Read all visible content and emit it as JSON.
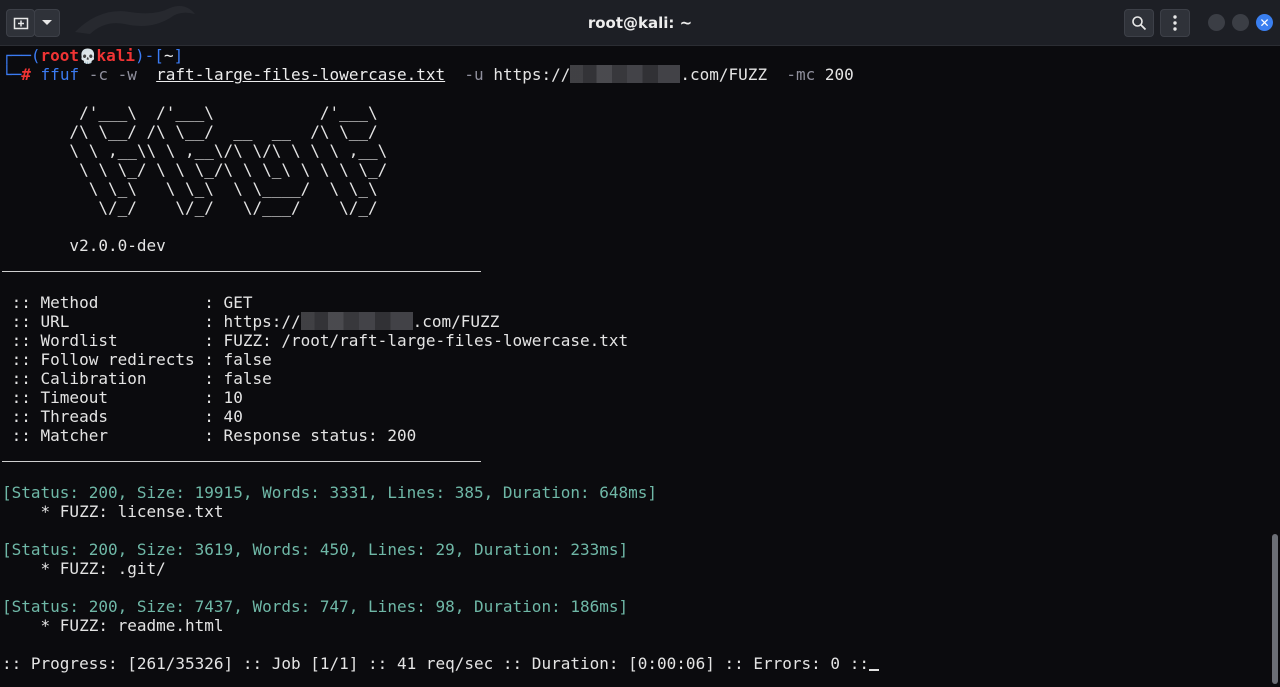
{
  "window": {
    "title": "root@kali: ~",
    "new_tab_icon": "new-tab-icon",
    "dropdown_icon": "chevron-down-icon",
    "search_icon": "search-icon",
    "menu_icon": "kebab-menu-icon",
    "close_icon": "close-icon"
  },
  "prompt": {
    "open": "┌──(",
    "user": "root",
    "skull": "💀",
    "host": "kali",
    "close": ")-[",
    "dir": "~",
    "end": "]",
    "line2": "└─",
    "hash": "#"
  },
  "command": {
    "cmd": "ffuf",
    "flag_c": "-c",
    "flag_w": "-w",
    "wordlist": "raft-large-files-lowercase.txt",
    "flag_u": "-u",
    "url_prefix": "https://",
    "url_suffix": ".com/FUZZ",
    "flag_mc": "-mc",
    "mc_value": "200"
  },
  "banner": {
    "art": [
      "        /'___\\  /'___\\           /'___\\       ",
      "       /\\ \\__/ /\\ \\__/  __  __  /\\ \\__/       ",
      "       \\ \\ ,__\\\\ \\ ,__\\/\\ \\/\\ \\ \\ \\ ,__\\      ",
      "        \\ \\ \\_/ \\ \\ \\_/\\ \\ \\_\\ \\ \\ \\ \\_/      ",
      "         \\ \\_\\   \\ \\_\\  \\ \\____/  \\ \\_\\       ",
      "          \\/_/    \\/_/   \\/___/    \\/_/       "
    ],
    "version": "       v2.0.0-dev"
  },
  "config": {
    "method": " :: Method           : GET",
    "url_prefix": " :: URL              : https://",
    "url_suffix": ".com/FUZZ",
    "wordlist": " :: Wordlist         : FUZZ: /root/raft-large-files-lowercase.txt",
    "follow": " :: Follow redirects : false",
    "calibration": " :: Calibration      : false",
    "timeout": " :: Timeout          : 10",
    "threads": " :: Threads          : 40",
    "matcher": " :: Matcher          : Response status: 200"
  },
  "results": [
    {
      "status": "[Status: 200, Size: 19915, Words: 3331, Lines: 385, Duration: 648ms]",
      "fuzz": "    * FUZZ: license.txt"
    },
    {
      "status": "[Status: 200, Size: 3619, Words: 450, Lines: 29, Duration: 233ms]",
      "fuzz": "    * FUZZ: .git/"
    },
    {
      "status": "[Status: 200, Size: 7437, Words: 747, Lines: 98, Duration: 186ms]",
      "fuzz": "    * FUZZ: readme.html"
    }
  ],
  "progress": ":: Progress: [261/35326] :: Job [1/1] :: 41 req/sec :: Duration: [0:00:06] :: Errors: 0 ::"
}
